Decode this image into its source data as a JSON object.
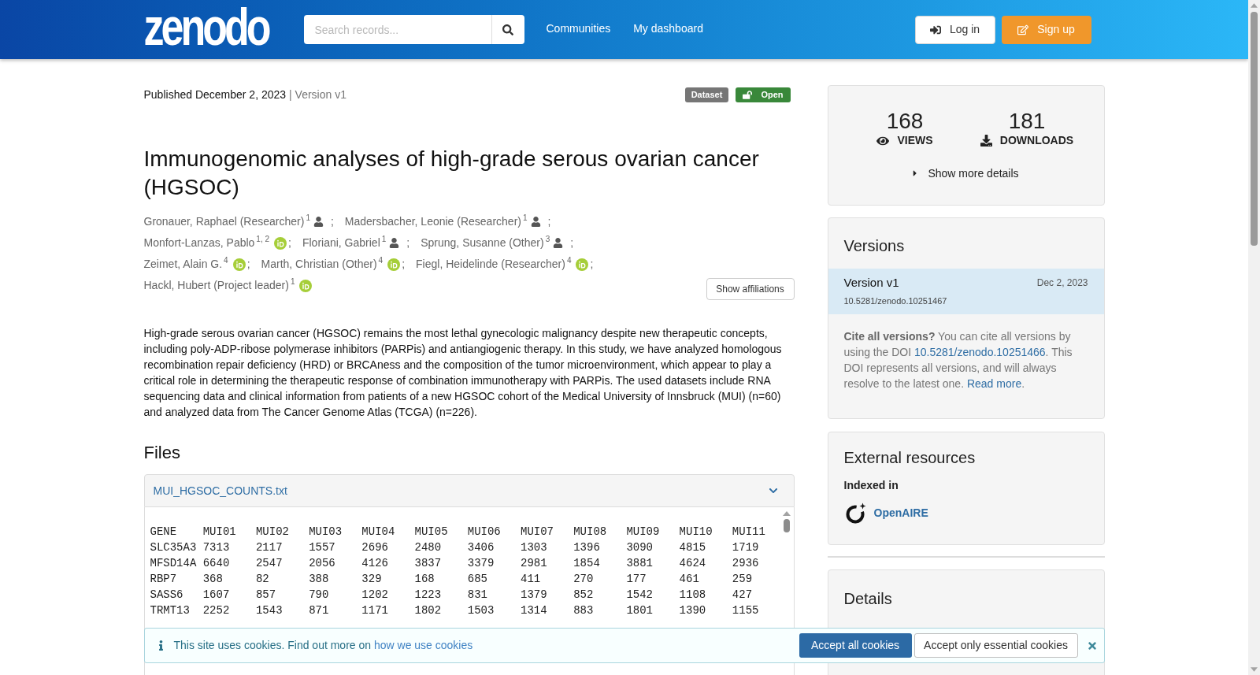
{
  "header": {
    "logo": "zenodo",
    "search": {
      "placeholder": "Search records..."
    },
    "nav": [
      "Communities",
      "My dashboard"
    ],
    "buttons": [
      {
        "kind": "login",
        "label": "Log in"
      },
      {
        "kind": "signup",
        "label": "Sign up"
      }
    ]
  },
  "record": {
    "published": "Published December 2, 2023",
    "version": "| Version v1",
    "badges": [
      {
        "kind": "resource_type",
        "label": "Dataset"
      },
      {
        "kind": "access",
        "label": "Open"
      }
    ],
    "title": "Immunogenomic analyses of high-grade serous ovarian cancer (HGSOC)",
    "creators": [
      {
        "name": "Gronauer, Raphael (Researcher)",
        "affiliations": "1",
        "kind": "person",
        "separator": ";"
      },
      {
        "name": "Madersbacher, Leonie (Researcher)",
        "affiliations": "1",
        "kind": "person",
        "separator": ";"
      },
      {
        "name": "Monfort-Lanzas, Pablo",
        "affiliations": "1, 2",
        "kind": "orcid",
        "separator": ";"
      },
      {
        "name": "Floriani, Gabriel",
        "affiliations": "1",
        "kind": "person",
        "separator": ";"
      },
      {
        "name": "Sprung, Susanne (Other)",
        "affiliations": "3",
        "kind": "person",
        "separator": ";"
      },
      {
        "name": "Zeimet, Alain G.",
        "affiliations": "4",
        "kind": "orcid",
        "separator": ";"
      },
      {
        "name": "Marth, Christian (Other)",
        "affiliations": "4",
        "kind": "orcid",
        "separator": ";"
      },
      {
        "name": "Fiegl, Heidelinde (Researcher)",
        "affiliations": "4",
        "kind": "orcid",
        "separator": ";"
      },
      {
        "name": "Hackl, Hubert (Project leader)",
        "affiliations": "1",
        "kind": "orcid"
      }
    ],
    "show_affiliations": "Show affiliations",
    "abstract": "High-grade serous ovarian cancer (HGSOC) remains the most lethal gynecologic malignancy despite new therapeutic concepts, including poly-ADP-ribose polymerase inhibitors (PARPis) and antiangiogenic therapy. In this study, we have analyzed homologous recombination repair deficiency (HRD) or BRCAness and the composition of the tumor microenvironment, which appear to play a critical role in determining the therapeutic response of combination immunotherapy with PARPis. The used datasets include RNA sequencing data and clinical information from patients of a new HGSOC cohort of the Medical University of Innsbruck (MUI) (n=60) and analyzed data from The Cancer Genome Atlas (TCGA) (n=226)."
  },
  "files": {
    "heading": "Files",
    "file": {
      "name": "MUI_HGSOC_COUNTS.txt",
      "expanded": true
    },
    "preview": {
      "header": [
        "GENE",
        "MUI01",
        "MUI02",
        "MUI03",
        "MUI04",
        "MUI05",
        "MUI06",
        "MUI07",
        "MUI08",
        "MUI09",
        "MUI10",
        "MUI11"
      ],
      "rows": [
        [
          "SLC35A3",
          "7313",
          "2117",
          "1557",
          "2696",
          "2480",
          "3406",
          "1303",
          "1396",
          "3090",
          "4815",
          "1719"
        ],
        [
          "MFSD14A",
          "6640",
          "2547",
          "2056",
          "4126",
          "3837",
          "3379",
          "2981",
          "1854",
          "3881",
          "4624",
          "2936"
        ],
        [
          "RBP7",
          "368",
          "82",
          "388",
          "329",
          "168",
          "685",
          "411",
          "270",
          "177",
          "461",
          "259"
        ],
        [
          "SASS6",
          "1607",
          "857",
          "790",
          "1202",
          "1223",
          "831",
          "1379",
          "852",
          "1542",
          "1108",
          "427"
        ],
        [
          "TRMT13",
          "2252",
          "1543",
          "871",
          "1171",
          "1802",
          "1503",
          "1314",
          "883",
          "1801",
          "1390",
          "1155"
        ]
      ]
    }
  },
  "stats": {
    "items": [
      {
        "kind": "views",
        "value": "168",
        "label": "VIEWS"
      },
      {
        "kind": "downloads",
        "value": "181",
        "label": "DOWNLOADS"
      }
    ],
    "more": {
      "label": "Show more details",
      "expanded": false
    }
  },
  "versions": {
    "heading": "Versions",
    "items": [
      {
        "title": "Version v1",
        "date": "Dec 2, 2023",
        "doi": "10.5281/zenodo.10251467",
        "selected": true
      }
    ],
    "cite": [
      {
        "kind": "bold",
        "text": "Cite all versions?"
      },
      {
        "kind": "text",
        "text": " You can cite all versions by using the DOI "
      },
      {
        "kind": "link",
        "text": "10.5281/zenodo.10251466"
      },
      {
        "kind": "text",
        "text": ". This DOI represents all versions, and will always resolve to the latest one. "
      },
      {
        "kind": "link",
        "text": "Read more"
      },
      {
        "kind": "text",
        "text": "."
      }
    ]
  },
  "external_resources": {
    "heading": "External resources",
    "indexed_label": "Indexed in",
    "items": [
      {
        "name": "OpenAIRE"
      }
    ]
  },
  "details": {
    "heading": "Details"
  },
  "cookie_banner": {
    "message": "This site uses cookies. Find out more on",
    "link": "how we use cookies",
    "buttons": [
      {
        "kind": "primary",
        "label": "Accept all cookies"
      },
      {
        "kind": "secondary",
        "label": "Accept only essential cookies"
      }
    ]
  }
}
